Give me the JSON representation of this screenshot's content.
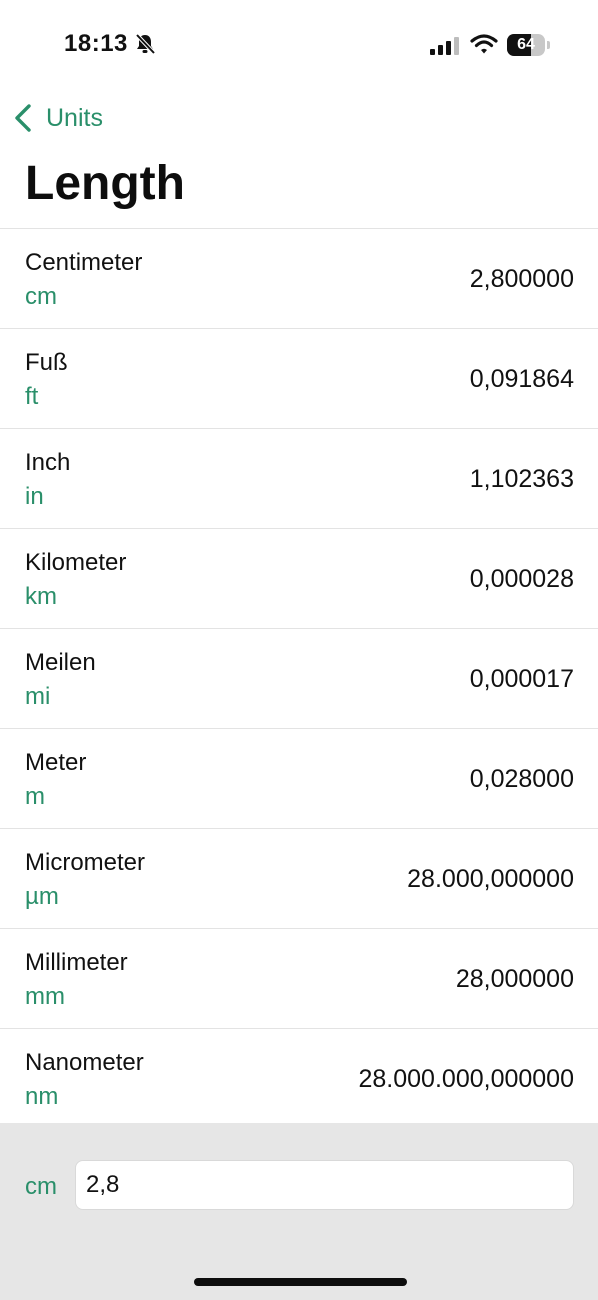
{
  "status_bar": {
    "time": "18:13",
    "battery": "64",
    "battery_fraction": 0.64,
    "icons": [
      "bell-slash-icon",
      "cellular-signal-icon",
      "wifi-icon",
      "battery-icon"
    ]
  },
  "nav": {
    "back_label": "Units",
    "back_icon": "chevron-left-icon",
    "title": "Length"
  },
  "units": [
    {
      "name": "Centimeter",
      "symbol": "cm",
      "value": "2,800000"
    },
    {
      "name": "Fuß",
      "symbol": "ft",
      "value": "0,091864"
    },
    {
      "name": "Inch",
      "symbol": "in",
      "value": "1,102363"
    },
    {
      "name": "Kilometer",
      "symbol": "km",
      "value": "0,000028"
    },
    {
      "name": "Meilen",
      "symbol": "mi",
      "value": "0,000017"
    },
    {
      "name": "Meter",
      "symbol": "m",
      "value": "0,028000"
    },
    {
      "name": "Micrometer",
      "symbol": "µm",
      "value": "28.000,000000"
    },
    {
      "name": "Millimeter",
      "symbol": "mm",
      "value": "28,000000"
    },
    {
      "name": "Nanometer",
      "symbol": "nm",
      "value": "28.000.000,000000"
    }
  ],
  "input": {
    "unit": "cm",
    "value": "2,8"
  },
  "colors": {
    "accent": "#2a8f6a",
    "panel_background": "#e6e6e6"
  }
}
